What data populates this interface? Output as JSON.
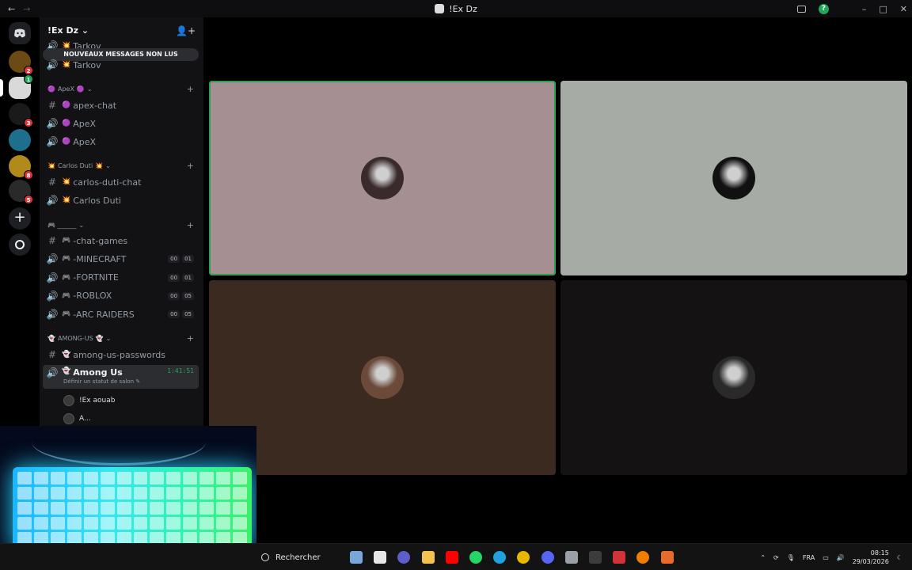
{
  "window": {
    "title": "!Ex Dz",
    "nav_back": "←",
    "nav_forward": "→",
    "minimize": "–",
    "maximize": "□",
    "close": "✕",
    "help": "?"
  },
  "servers": [
    {
      "name": "server-1",
      "badge": "2",
      "color": "#6b4a14"
    },
    {
      "name": "server-2",
      "badge": "1",
      "color": "#d9d9d9",
      "selected": true
    },
    {
      "name": "server-3",
      "badge": "3",
      "color": "#1a1a1a"
    },
    {
      "name": "server-4",
      "badge": "",
      "color": "#1e6e8e"
    },
    {
      "name": "server-5",
      "badge": "8",
      "color": "#b08a1a"
    },
    {
      "name": "server-6",
      "badge": "5",
      "color": "#2a2a2a"
    }
  ],
  "sidebar": {
    "server_name": "!Ex Dz",
    "unread_banner": "NOUVEAUX MESSAGES NON LUS",
    "top_partial": "Tarkov",
    "top_voice": "Tarkov",
    "categories": [
      {
        "name": "ApeX",
        "prefix": "🟣",
        "suffix": "🟣"
      },
      {
        "name": "Carlos Duti",
        "prefix": "💥",
        "suffix": "💥"
      },
      {
        "name": "______",
        "prefix": "",
        "suffix": "🎮 ______"
      },
      {
        "name": "AMONG-US",
        "prefix": "👻",
        "suffix": "👻"
      }
    ],
    "apex": [
      {
        "type": "text",
        "emoji": "🟣",
        "label": "apex-chat"
      },
      {
        "type": "voice",
        "emoji": "🟣",
        "label": "ApeX"
      },
      {
        "type": "voice",
        "emoji": "🟣",
        "label": "ApeX"
      }
    ],
    "carlos": [
      {
        "type": "text",
        "emoji": "💥",
        "label": "carlos-duti-chat"
      },
      {
        "type": "voice",
        "emoji": "💥",
        "label": "Carlos Duti"
      }
    ],
    "games": [
      {
        "type": "text",
        "emoji": "🎮",
        "label": "-chat-games"
      },
      {
        "type": "voice",
        "emoji": "🎮",
        "label": "-MINECRAFT",
        "c1": "00",
        "c2": "01"
      },
      {
        "type": "voice",
        "emoji": "🎮",
        "label": "-FORTNITE",
        "c1": "00",
        "c2": "01"
      },
      {
        "type": "voice",
        "emoji": "🎮",
        "label": "-ROBLOX",
        "c1": "00",
        "c2": "05"
      },
      {
        "type": "voice",
        "emoji": "🎮",
        "label": "-ARC RAIDERS",
        "c1": "00",
        "c2": "05"
      }
    ],
    "among": [
      {
        "type": "text",
        "emoji": "👻",
        "label": "among-us-passwords"
      },
      {
        "type": "voice",
        "emoji": "👻",
        "label": "Among Us",
        "time": "1:41:51",
        "status": "Définir un statut de salon"
      }
    ],
    "members": [
      {
        "name": "!Ex aouab"
      },
      {
        "name": "A..."
      }
    ]
  },
  "stage": {
    "tiles": [
      {
        "color": "#a68f93",
        "face": "#3a2a2c",
        "speaking": true
      },
      {
        "color": "#a7aba6",
        "face": "#111111",
        "speaking": false
      },
      {
        "color": "#3b2a1f",
        "face": "#6b4a3a",
        "speaking": false
      },
      {
        "color": "#141212",
        "face": "#2a2a2a",
        "speaking": false
      }
    ]
  },
  "taskbar": {
    "search_label": "Rechercher",
    "language": "FRA",
    "time": "08:15",
    "date": "29/03/2026",
    "apps": [
      {
        "name": "copilot-icon",
        "color": "#7aa7d8"
      },
      {
        "name": "taskview-icon",
        "color": "#e6e6e6"
      },
      {
        "name": "teams-icon",
        "color": "#5b5fc7"
      },
      {
        "name": "explorer-icon",
        "color": "#f2c14e"
      },
      {
        "name": "youtube-icon",
        "color": "#ff0000"
      },
      {
        "name": "whatsapp-icon",
        "color": "#25d366"
      },
      {
        "name": "edge-icon",
        "color": "#1fa2e0"
      },
      {
        "name": "chrome-icon",
        "color": "#e8b700"
      },
      {
        "name": "discord-icon",
        "color": "#5865f2"
      },
      {
        "name": "settings-icon",
        "color": "#9aa0a6"
      },
      {
        "name": "terminal-icon",
        "color": "#3c3c3c"
      },
      {
        "name": "app-red-icon",
        "color": "#d13438"
      },
      {
        "name": "color-icon",
        "color": "#f07c00"
      },
      {
        "name": "mic-icon",
        "color": "#e86b2c"
      }
    ]
  }
}
